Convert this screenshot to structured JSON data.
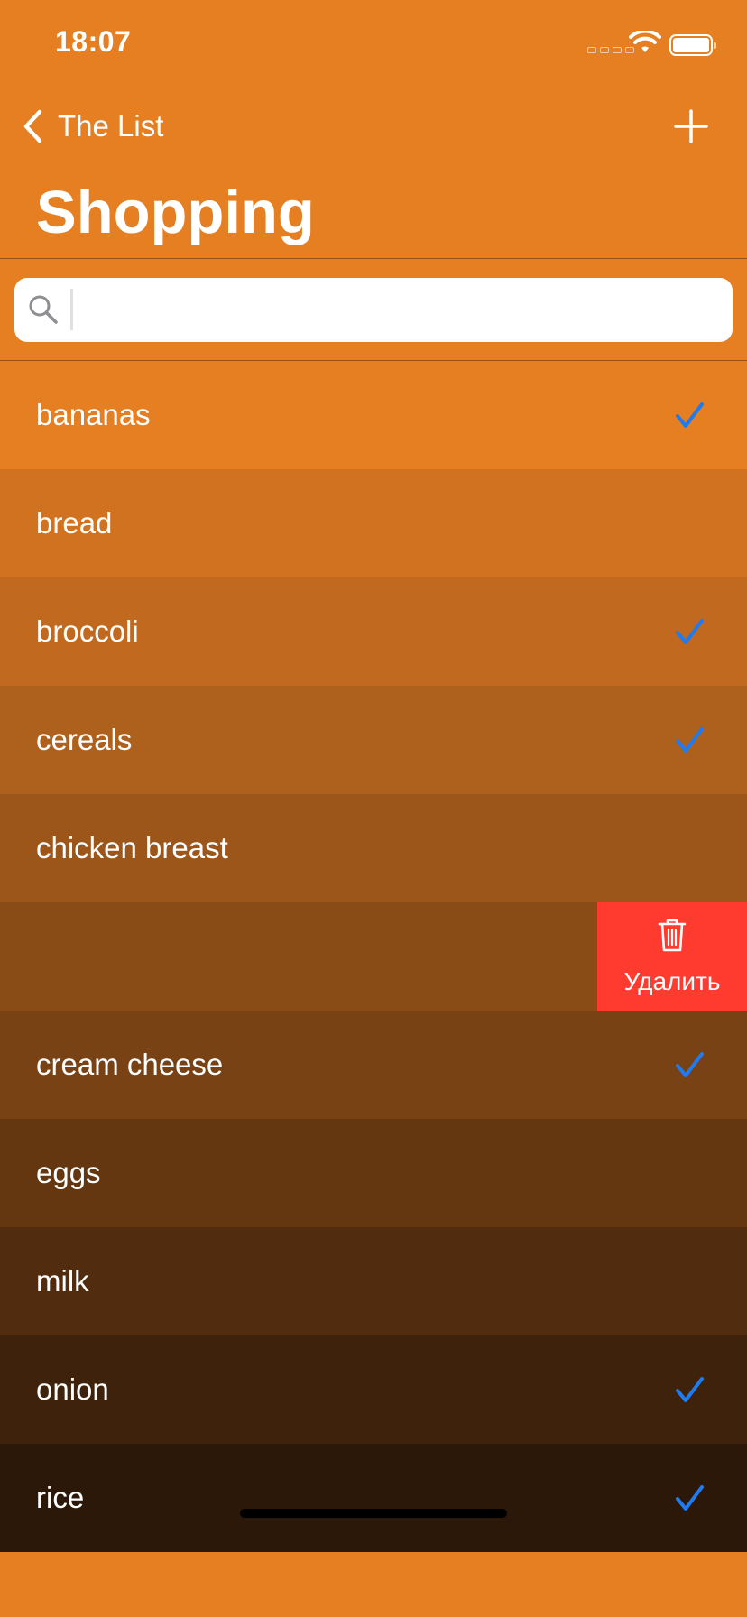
{
  "status_bar": {
    "time": "18:07"
  },
  "nav": {
    "back_label": "The List",
    "title": "Shopping",
    "back_icon": "chevron-left-icon",
    "add_icon": "plus-icon"
  },
  "search": {
    "value": "",
    "placeholder": ""
  },
  "list": {
    "check_color": "#1E7BF2",
    "items": [
      {
        "label": "bananas",
        "checked": true,
        "bg": "#E67E22"
      },
      {
        "label": "bread",
        "checked": false,
        "bg": "#D17220"
      },
      {
        "label": "broccoli",
        "checked": true,
        "bg": "#C0691F"
      },
      {
        "label": "cereals",
        "checked": true,
        "bg": "#AE601D"
      },
      {
        "label": "chicken breast",
        "checked": false,
        "bg": "#9C561A"
      },
      {
        "label": "",
        "checked": false,
        "bg": "#8A4C17",
        "swiped": true,
        "delete_label": "Удалить",
        "delete_color": "#FF3B30"
      },
      {
        "label": "cream cheese",
        "checked": true,
        "bg": "#784214"
      },
      {
        "label": "eggs",
        "checked": false,
        "bg": "#643711"
      },
      {
        "label": "milk",
        "checked": false,
        "bg": "#512C0E"
      },
      {
        "label": "onion",
        "checked": true,
        "bg": "#3E220B"
      },
      {
        "label": "rice",
        "checked": true,
        "bg": "#2C1808"
      }
    ]
  },
  "colors": {
    "background": "#E67E22"
  }
}
